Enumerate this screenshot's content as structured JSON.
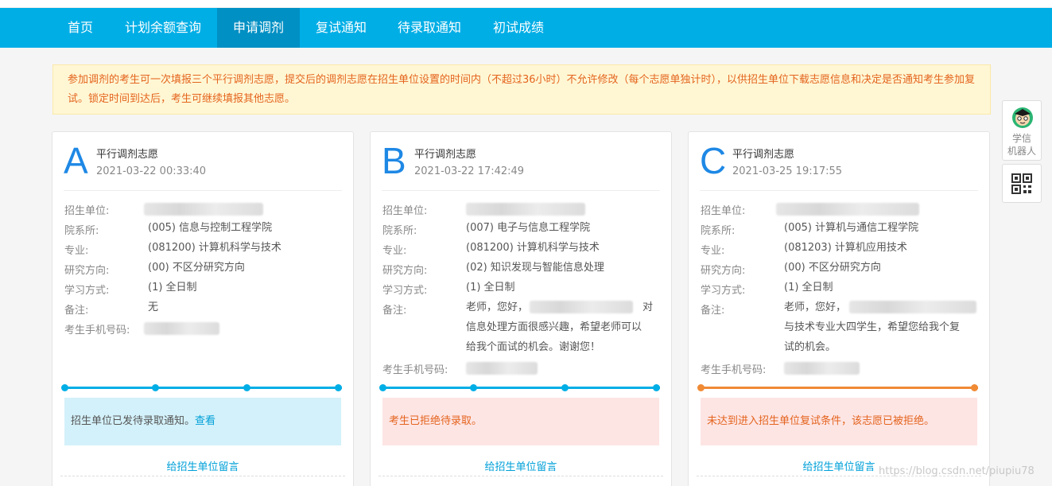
{
  "nav": {
    "items": [
      {
        "label": "首页"
      },
      {
        "label": "计划余额查询"
      },
      {
        "label": "申请调剂",
        "active": true
      },
      {
        "label": "复试通知"
      },
      {
        "label": "待录取通知"
      },
      {
        "label": "初试成绩"
      }
    ]
  },
  "notice": {
    "text": "参加调剂的考生可一次填报三个平行调剂志愿，提交后的调剂志愿在招生单位设置的时间内（不超过36小时）不允许修改（每个志愿单独计时），以供招生单位下载志愿信息和决定是否通知考生参加复试。锁定时间到达后，考生可继续填报其他志愿。"
  },
  "labels": {
    "unit": "招生单位:",
    "dept": "院系所:",
    "major": "专业:",
    "direction": "研究方向:",
    "mode": "学习方式:",
    "remark": "备注:",
    "phone": "考生手机号码:",
    "message": "给招生单位留言"
  },
  "cards": [
    {
      "letter": "A",
      "title": "平行调剂志愿",
      "date": "2021-03-22 00:33:40",
      "dept": "(005) 信息与控制工程学院",
      "major": "(081200) 计算机科学与技术",
      "direction": "(00) 不区分研究方向",
      "mode": "(1) 全日制",
      "remark": "无",
      "status": "招生单位已发待录取通知。",
      "status_link": "查看",
      "accent": "#00aee6",
      "status_bg": "#d3f1fa",
      "status_color": "#555555"
    },
    {
      "letter": "B",
      "title": "平行调剂志愿",
      "date": "2021-03-22 17:42:49",
      "dept": "(007) 电子与信息工程学院",
      "major": "(081200) 计算机科学与技术",
      "direction": "(02) 知识发现与智能信息处理",
      "mode": "(1) 全日制",
      "remark_line1_left": "老师，您好，",
      "remark_line1_right": "对",
      "remark_line2": "信息处理方面很感兴趣，希望老师可以",
      "remark_line3": "给我个面试的机会。谢谢您！",
      "status": "考生已拒绝待录取。",
      "accent": "#00aee6",
      "status_bg": "#fde5e4",
      "status_color": "#e4641e"
    },
    {
      "letter": "C",
      "title": "平行调剂志愿",
      "date": "2021-03-25 19:17:55",
      "dept": "(005) 计算机与通信工程学院",
      "major": "(081203) 计算机应用技术",
      "direction": "(00) 不区分研究方向",
      "mode": "(1) 全日制",
      "remark_line1_left": "老师，您好，",
      "remark_line2": "与技术专业大四学生，希望您给我个复",
      "remark_line3": "试的机会。",
      "status": "未达到进入招生单位复试条件，该志愿已被拒绝。",
      "accent": "#00aee6",
      "track_color": "#f08a35",
      "status_bg": "#fde5e4",
      "status_color": "#e4641e"
    }
  ],
  "side": {
    "robot_label_1": "学信",
    "robot_label_2": "机器人"
  },
  "watermark": "https://blog.csdn.net/piupiu78"
}
